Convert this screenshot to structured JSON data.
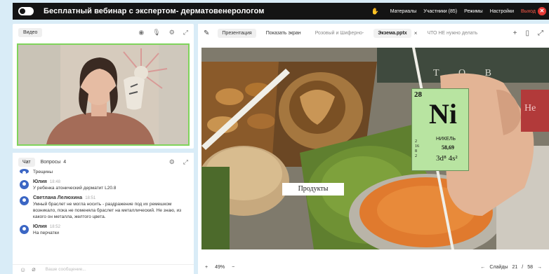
{
  "app": {
    "title": "Бесплатный вебинар с экспертом- дерматовенерологом",
    "menu": {
      "materials": "Материалы",
      "participants": "Участники (85)",
      "modes": "Режимы",
      "settings": "Настройки",
      "exit": "Выход"
    }
  },
  "video": {
    "label": "Видео"
  },
  "chat": {
    "tab_chat": "Чат",
    "tab_questions": "Вопросы",
    "questions_count": "4",
    "messages": [
      {
        "author": "",
        "time": "",
        "text": "Трещины"
      },
      {
        "author": "Юлия",
        "time": "18:48",
        "text": "У ребенка атонический дерматит L20.8"
      },
      {
        "author": "Светлана Лелюхина",
        "time": "18:51",
        "text": "Умный браслет не могла носить - раздражение под их ремешком возникало, пока не поменяла браслет на металлический. Не знаю, из какого он металла, желтого цвета."
      },
      {
        "author": "Юлия",
        "time": "18:52",
        "text": "На перчатки"
      }
    ],
    "input_placeholder": "Ваше сообщение..."
  },
  "presentation": {
    "btn_presentation": "Презентация",
    "btn_show_screen": "Показать экран",
    "files": [
      {
        "name": "Розовый и Шиферно-",
        "active": false
      },
      {
        "name": "Экзема.pptx",
        "active": true
      },
      {
        "name": "ЧТО НЕ нужно делать",
        "active": false
      }
    ],
    "zoom": "49%",
    "slides_label": "Слайды",
    "slide_current": "21",
    "slide_total": "58",
    "slide": {
      "label": "Продукты",
      "element_number": "28",
      "element_symbol": "Ni",
      "element_name": "НИКЕЛЬ",
      "element_mass": "58,69",
      "element_shells": "2 16 8 2",
      "element_config": "3d⁸ 4s²",
      "banner_text": "Т О В"
    }
  },
  "colors": {
    "topbar_bg": "#141414",
    "video_border": "#7fd45b",
    "avatar": "#3b66c4",
    "exit": "#e53935",
    "element_card": "#b8e4a1"
  }
}
